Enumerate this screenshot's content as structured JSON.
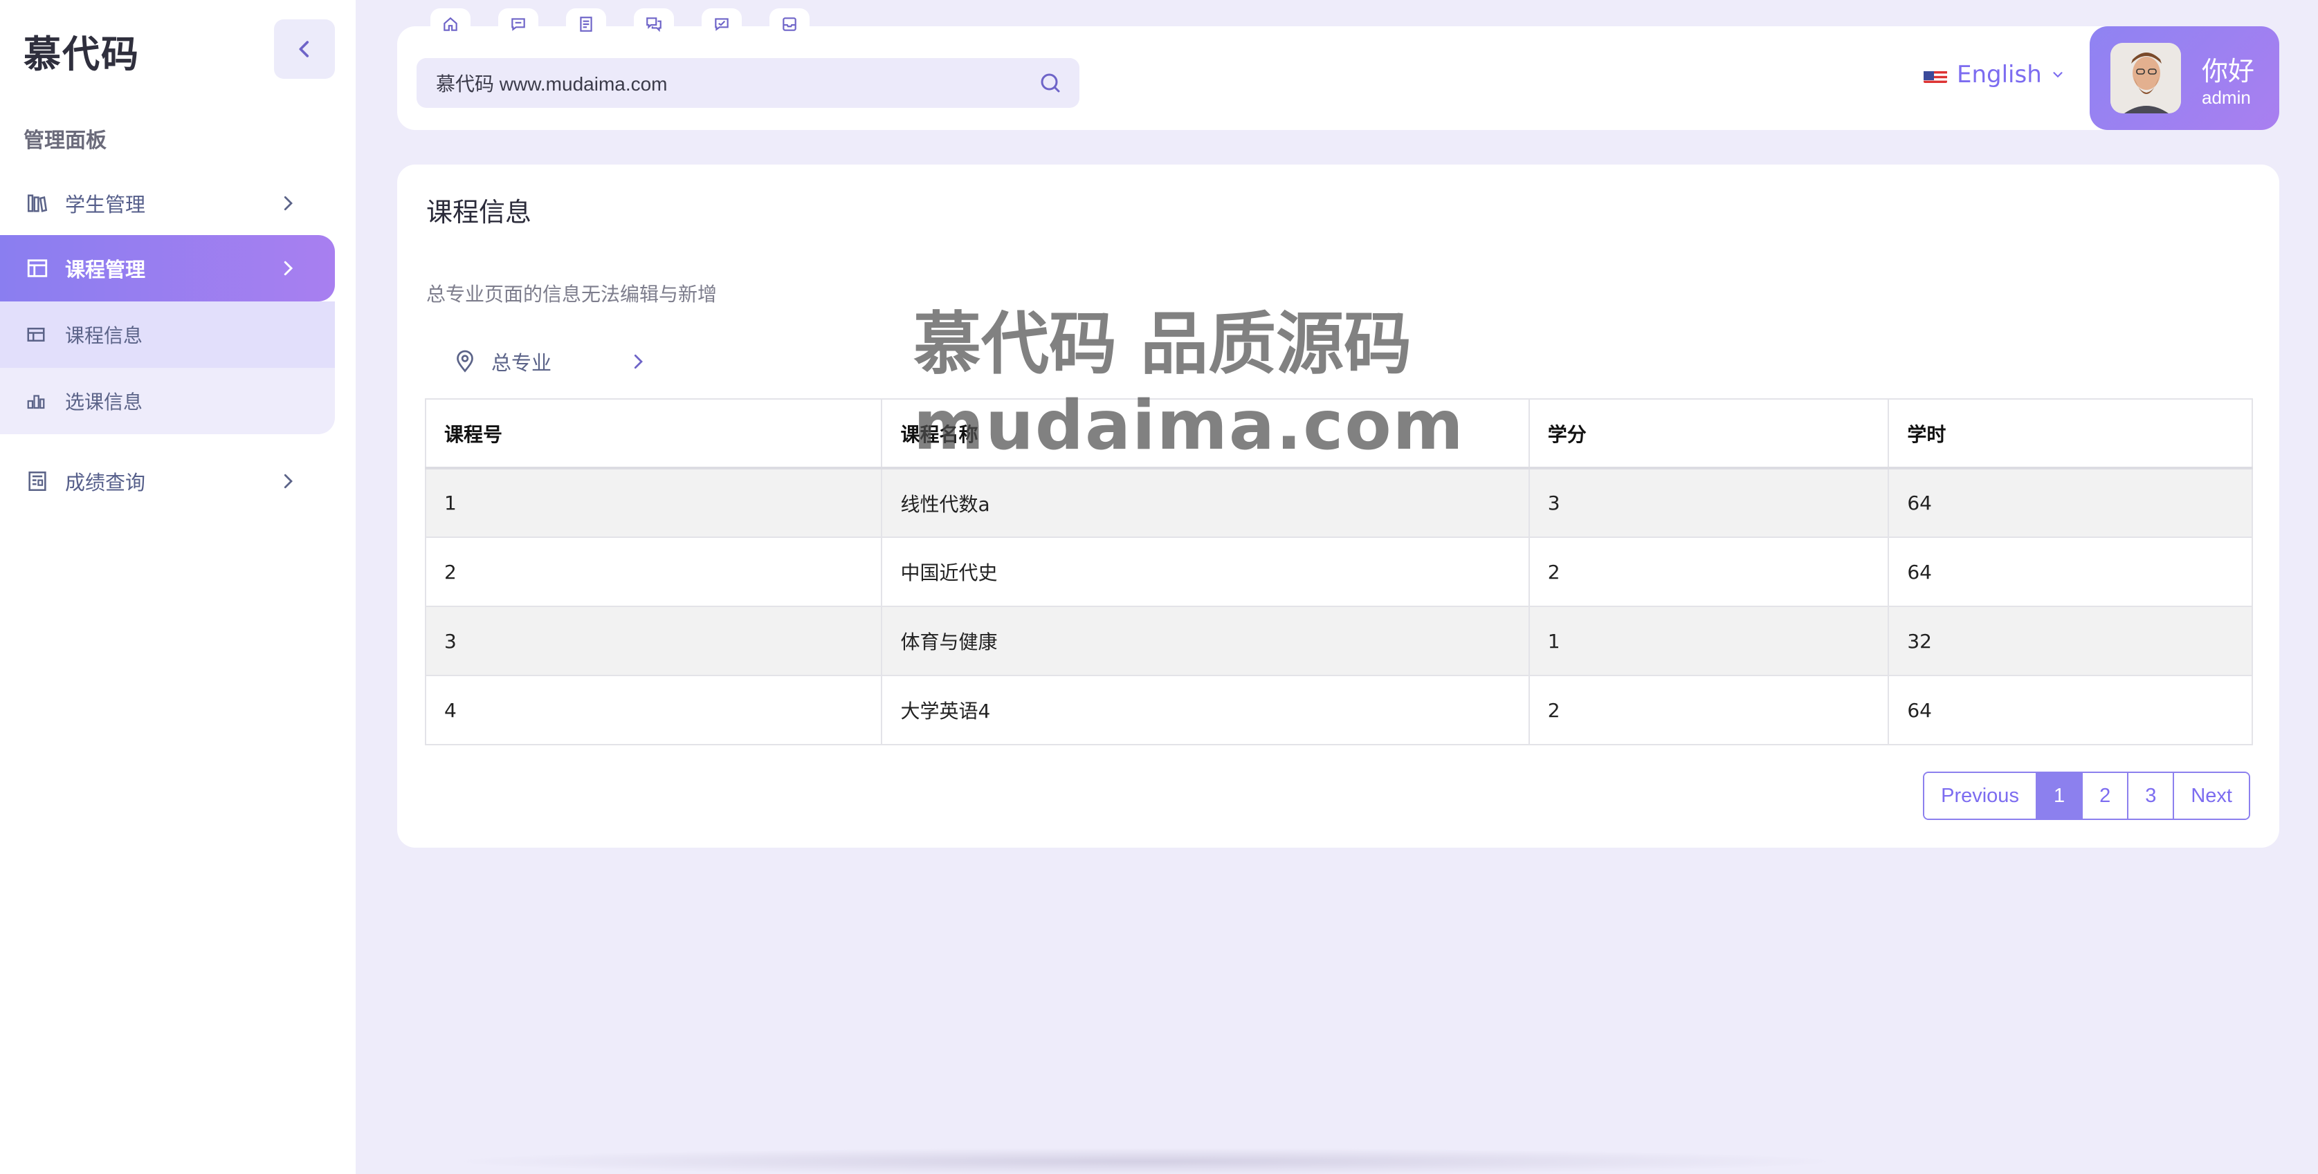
{
  "brand": "慕代码",
  "sidebar": {
    "section_label": "管理面板",
    "items": [
      {
        "label": "学生管理",
        "icon": "bookshelf-icon"
      },
      {
        "label": "课程管理",
        "icon": "grid-table-icon"
      },
      {
        "label": "成绩查询",
        "icon": "report-icon"
      }
    ],
    "submenu": [
      {
        "label": "课程信息",
        "icon": "grid-table-icon"
      },
      {
        "label": "选课信息",
        "icon": "bar-chart-icon"
      }
    ]
  },
  "header": {
    "quick_tabs": [
      "home-icon",
      "message-icon",
      "document-icon",
      "chat-icon",
      "check-message-icon",
      "inbox-icon"
    ],
    "search_value": "慕代码 www.mudaima.com",
    "language": "English",
    "greeting": "你好",
    "username": "admin"
  },
  "main": {
    "title": "课程信息",
    "notice": "总专业页面的信息无法编辑与新增",
    "major": "总专业",
    "columns": [
      "课程号",
      "课程名称",
      "学分",
      "学时"
    ],
    "rows": [
      [
        "1",
        "线性代数a",
        "3",
        "64"
      ],
      [
        "2",
        "中国近代史",
        "2",
        "64"
      ],
      [
        "3",
        "体育与健康",
        "1",
        "32"
      ],
      [
        "4",
        "大学英语4",
        "2",
        "64"
      ]
    ],
    "pagination": {
      "previous": "Previous",
      "pages": [
        "1",
        "2",
        "3"
      ],
      "next": "Next",
      "current": "1"
    }
  },
  "watermark": {
    "line1": "慕代码 品质源码",
    "line2": "mudaima.com"
  },
  "colors": {
    "accent": "#8c80ee",
    "gradient_end": "#a87ff0",
    "background": "#eeecfa"
  }
}
